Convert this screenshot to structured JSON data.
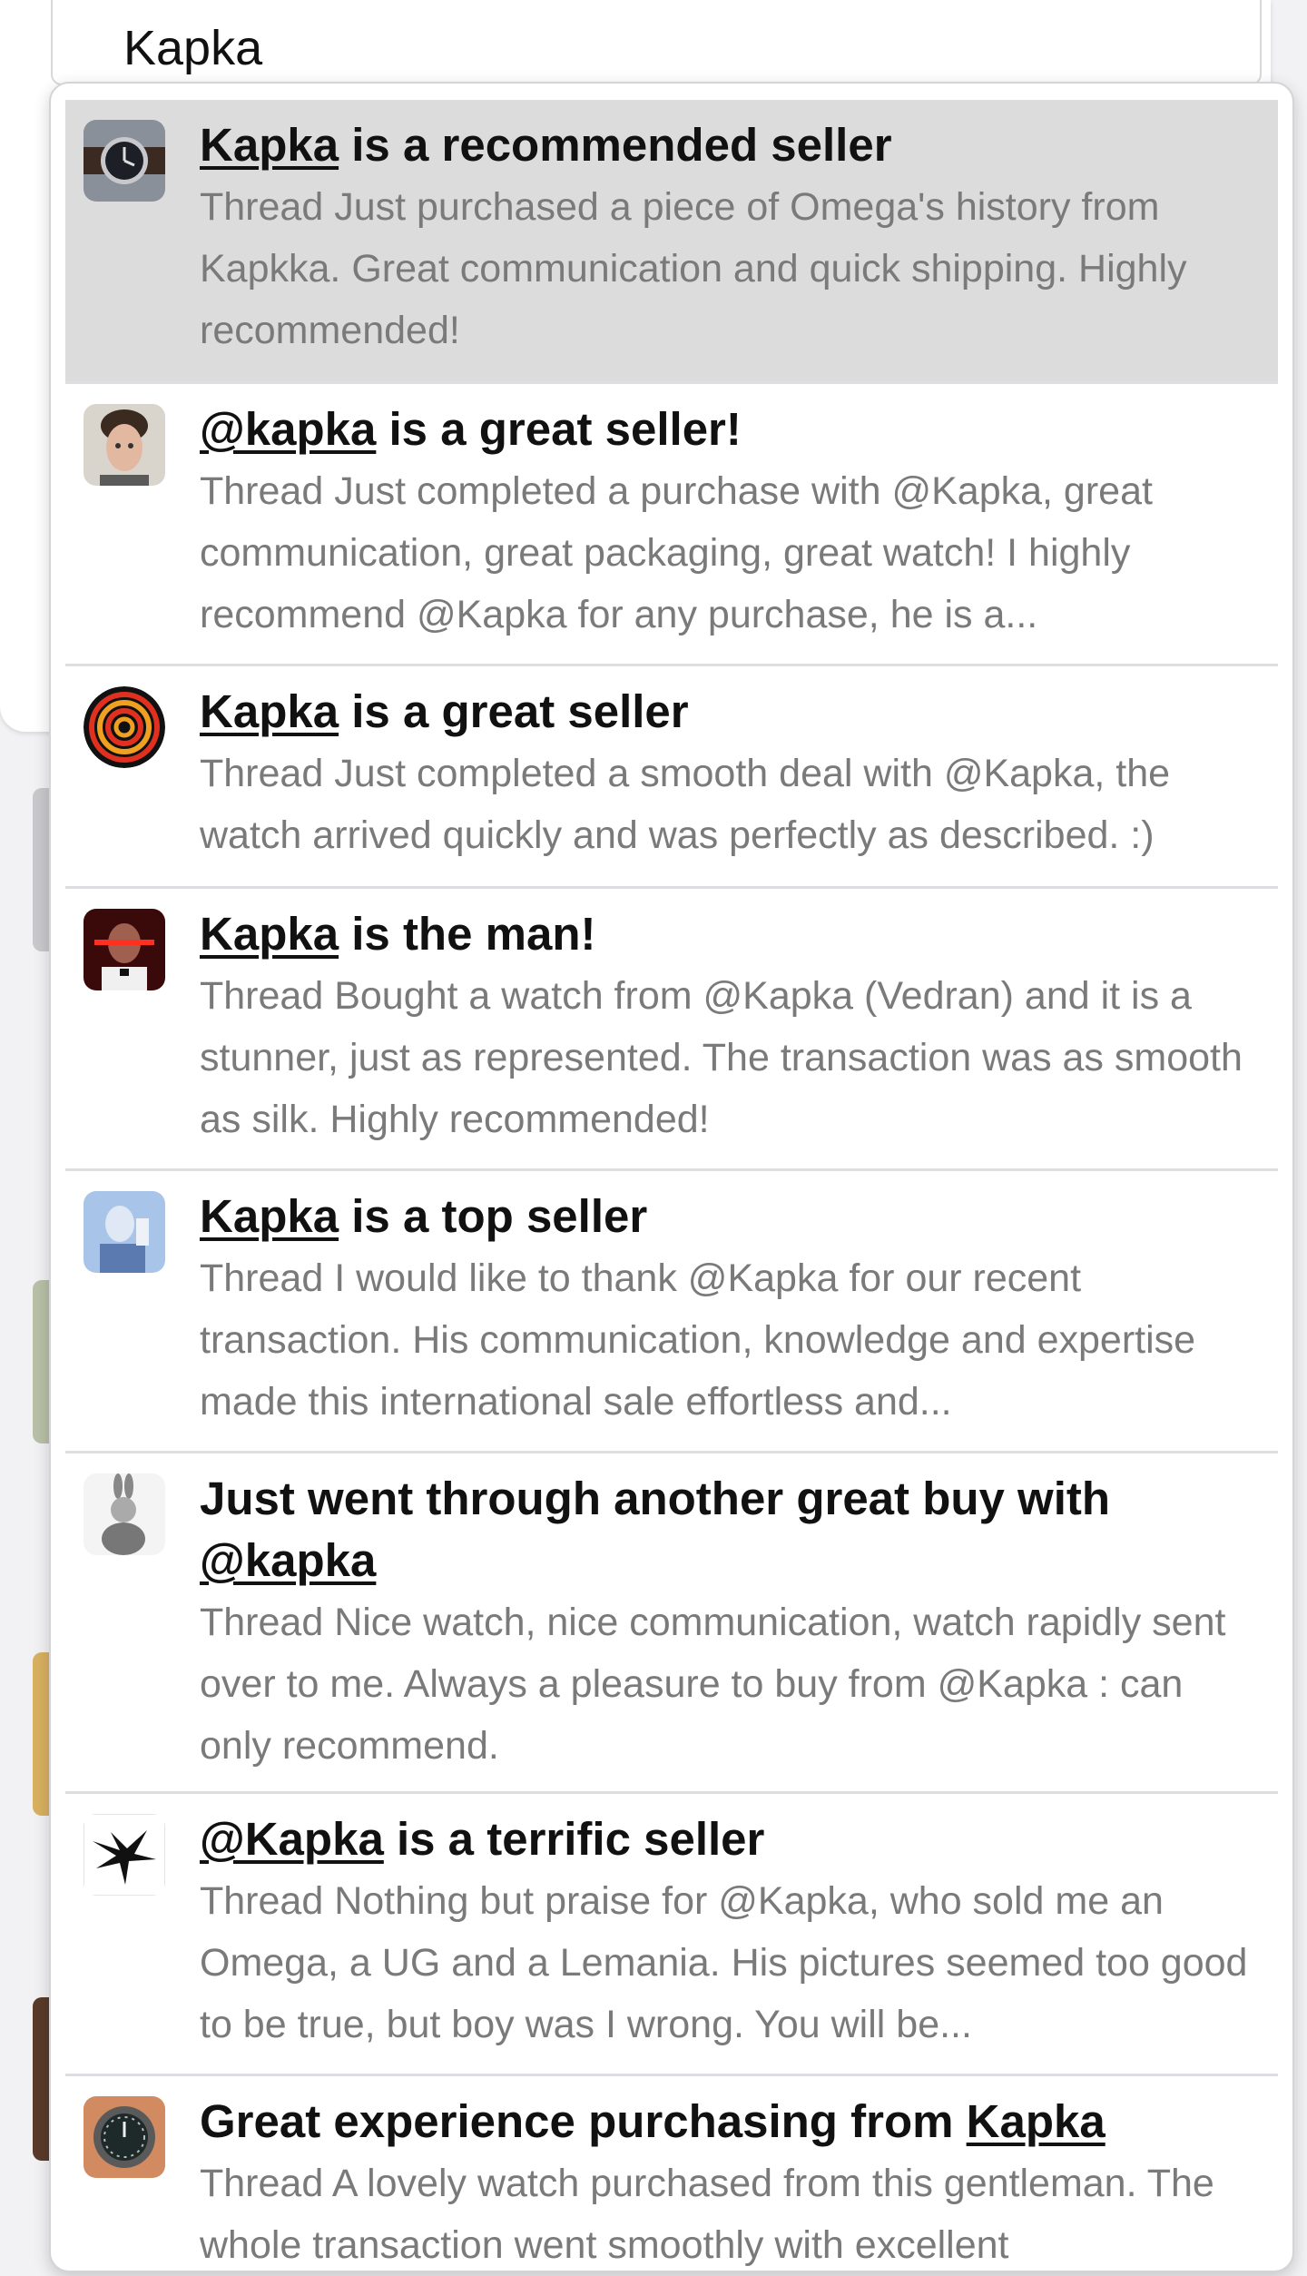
{
  "search": {
    "value": "Kapka"
  },
  "results": [
    {
      "avatar_icon": "wristwatch-avatar",
      "title_link": "Kapka",
      "title_rest": " is a recommended seller",
      "snippet": "Thread Just purchased a piece of Omega's history from Kapkka. Great communication and quick shipping. Highly recommended!",
      "selected": true
    },
    {
      "avatar_icon": "man-portrait-avatar",
      "title_link": "@kapka",
      "title_rest": " is a great seller!",
      "snippet": "Thread Just completed a purchase with @Kapka, great communication, great packaging, great watch! I highly recommend @Kapka for any purchase, he is a..."
    },
    {
      "avatar_icon": "spiral-avatar",
      "title_link": "Kapka",
      "title_rest": " is a great seller",
      "snippet": "Thread Just completed a smooth deal with @Kapka, the watch arrived quickly and was perfectly as described. :)"
    },
    {
      "avatar_icon": "red-eyes-avatar",
      "title_link": "Kapka",
      "title_rest": " is the man!",
      "snippet": "Thread Bought a watch from @Kapka (Vedran) and it is a stunner, just as represented. The transaction was as smooth as silk. Highly recommended!"
    },
    {
      "avatar_icon": "blue-portrait-avatar",
      "title_link": "Kapka",
      "title_rest": " is a top seller",
      "snippet": "Thread I would like to thank @Kapka for our recent transaction. His communication, knowledge and expertise made this international sale effortless and..."
    },
    {
      "avatar_icon": "rabbit-sketch-avatar",
      "title_prefix": "Just went through another great buy with ",
      "title_link": "@kapka",
      "snippet": "Thread Nice watch, nice communication, watch rapidly sent over to me. Always a pleasure to buy from @Kapka : can only recommend."
    },
    {
      "avatar_icon": "black-bird-avatar",
      "title_link": "@Kapka",
      "title_rest": " is a terrific seller",
      "snippet": "Thread Nothing but praise for @Kapka, who sold me an Omega, a UG and a Lemania. His pictures seemed too good to be true, but boy was I wrong. You will be..."
    },
    {
      "avatar_icon": "dive-watch-avatar",
      "title_prefix": "Great experience purchasing from ",
      "title_link": "Kapka",
      "snippet": "Thread A lovely watch purchased from this gentleman. The whole transaction went smoothly with excellent"
    }
  ]
}
